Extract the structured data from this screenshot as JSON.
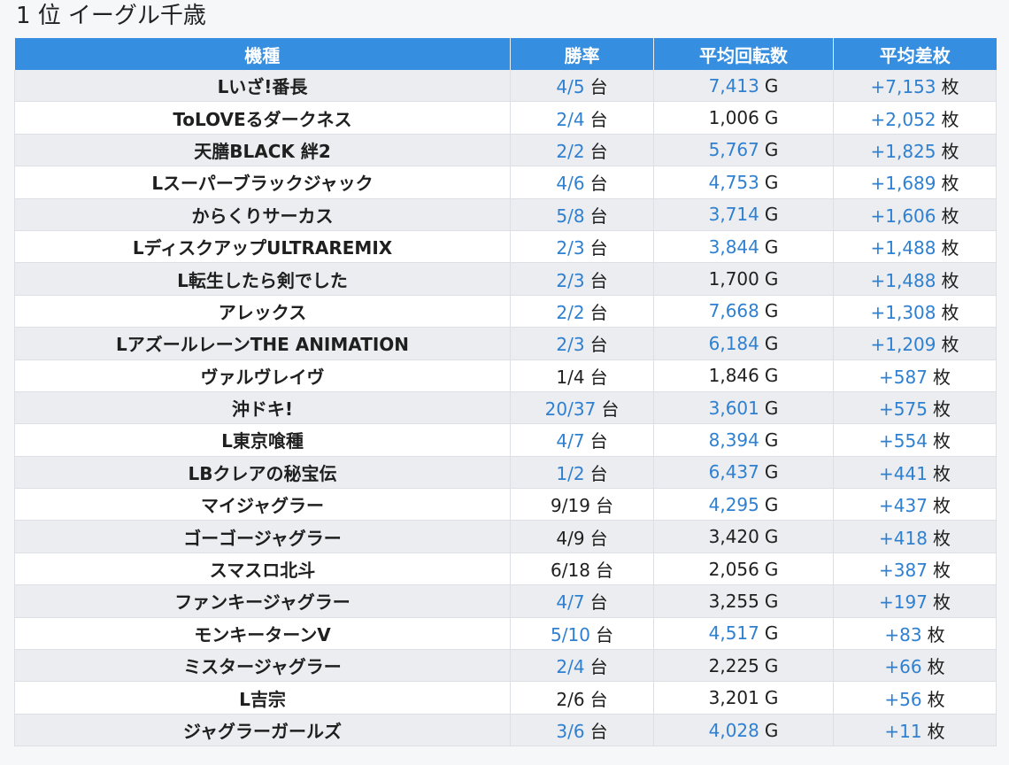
{
  "header": {
    "rank": "1 位",
    "store": "イーグル千歳"
  },
  "columns": [
    "機種",
    "勝率",
    "平均回転数",
    "平均差枚"
  ],
  "units": {
    "win": "台",
    "spins": "G",
    "diff": "枚"
  },
  "colors": {
    "header_bg": "#368ee0",
    "highlight_text": "#2f80d0",
    "row_odd": "#ebedf0",
    "row_even": "#ffffff"
  },
  "rows": [
    {
      "name": "Lいざ!番長",
      "win": "4/5",
      "win_hl": true,
      "spins": "7,413",
      "spins_hl": true,
      "diff": "+7,153"
    },
    {
      "name": "ToLOVEるダークネス",
      "win": "2/4",
      "win_hl": true,
      "spins": "1,006",
      "spins_hl": false,
      "diff": "+2,052"
    },
    {
      "name": "天膳BLACK 絆2",
      "win": "2/2",
      "win_hl": true,
      "spins": "5,767",
      "spins_hl": true,
      "diff": "+1,825"
    },
    {
      "name": "Lスーパーブラックジャック",
      "win": "4/6",
      "win_hl": true,
      "spins": "4,753",
      "spins_hl": true,
      "diff": "+1,689"
    },
    {
      "name": "からくりサーカス",
      "win": "5/8",
      "win_hl": true,
      "spins": "3,714",
      "spins_hl": true,
      "diff": "+1,606"
    },
    {
      "name": "LディスクアップULTRAREMIX",
      "win": "2/3",
      "win_hl": true,
      "spins": "3,844",
      "spins_hl": true,
      "diff": "+1,488"
    },
    {
      "name": "L転生したら剣でした",
      "win": "2/3",
      "win_hl": true,
      "spins": "1,700",
      "spins_hl": false,
      "diff": "+1,488"
    },
    {
      "name": "アレックス",
      "win": "2/2",
      "win_hl": true,
      "spins": "7,668",
      "spins_hl": true,
      "diff": "+1,308"
    },
    {
      "name": "LアズールレーンTHE ANIMATION",
      "win": "2/3",
      "win_hl": true,
      "spins": "6,184",
      "spins_hl": true,
      "diff": "+1,209"
    },
    {
      "name": "ヴァルヴレイヴ",
      "win": "1/4",
      "win_hl": false,
      "spins": "1,846",
      "spins_hl": false,
      "diff": "+587"
    },
    {
      "name": "沖ドキ!",
      "win": "20/37",
      "win_hl": true,
      "spins": "3,601",
      "spins_hl": true,
      "diff": "+575"
    },
    {
      "name": "L東京喰種",
      "win": "4/7",
      "win_hl": true,
      "spins": "8,394",
      "spins_hl": true,
      "diff": "+554"
    },
    {
      "name": "LBクレアの秘宝伝",
      "win": "1/2",
      "win_hl": true,
      "spins": "6,437",
      "spins_hl": true,
      "diff": "+441"
    },
    {
      "name": "マイジャグラー",
      "win": "9/19",
      "win_hl": false,
      "spins": "4,295",
      "spins_hl": true,
      "diff": "+437"
    },
    {
      "name": "ゴーゴージャグラー",
      "win": "4/9",
      "win_hl": false,
      "spins": "3,420",
      "spins_hl": false,
      "diff": "+418"
    },
    {
      "name": "スマスロ北斗",
      "win": "6/18",
      "win_hl": false,
      "spins": "2,056",
      "spins_hl": false,
      "diff": "+387"
    },
    {
      "name": "ファンキージャグラー",
      "win": "4/7",
      "win_hl": true,
      "spins": "3,255",
      "spins_hl": false,
      "diff": "+197"
    },
    {
      "name": "モンキーターンV",
      "win": "5/10",
      "win_hl": true,
      "spins": "4,517",
      "spins_hl": true,
      "diff": "+83"
    },
    {
      "name": "ミスタージャグラー",
      "win": "2/4",
      "win_hl": true,
      "spins": "2,225",
      "spins_hl": false,
      "diff": "+66"
    },
    {
      "name": "L吉宗",
      "win": "2/6",
      "win_hl": false,
      "spins": "3,201",
      "spins_hl": false,
      "diff": "+56"
    },
    {
      "name": "ジャグラーガールズ",
      "win": "3/6",
      "win_hl": true,
      "spins": "4,028",
      "spins_hl": true,
      "diff": "+11"
    }
  ]
}
